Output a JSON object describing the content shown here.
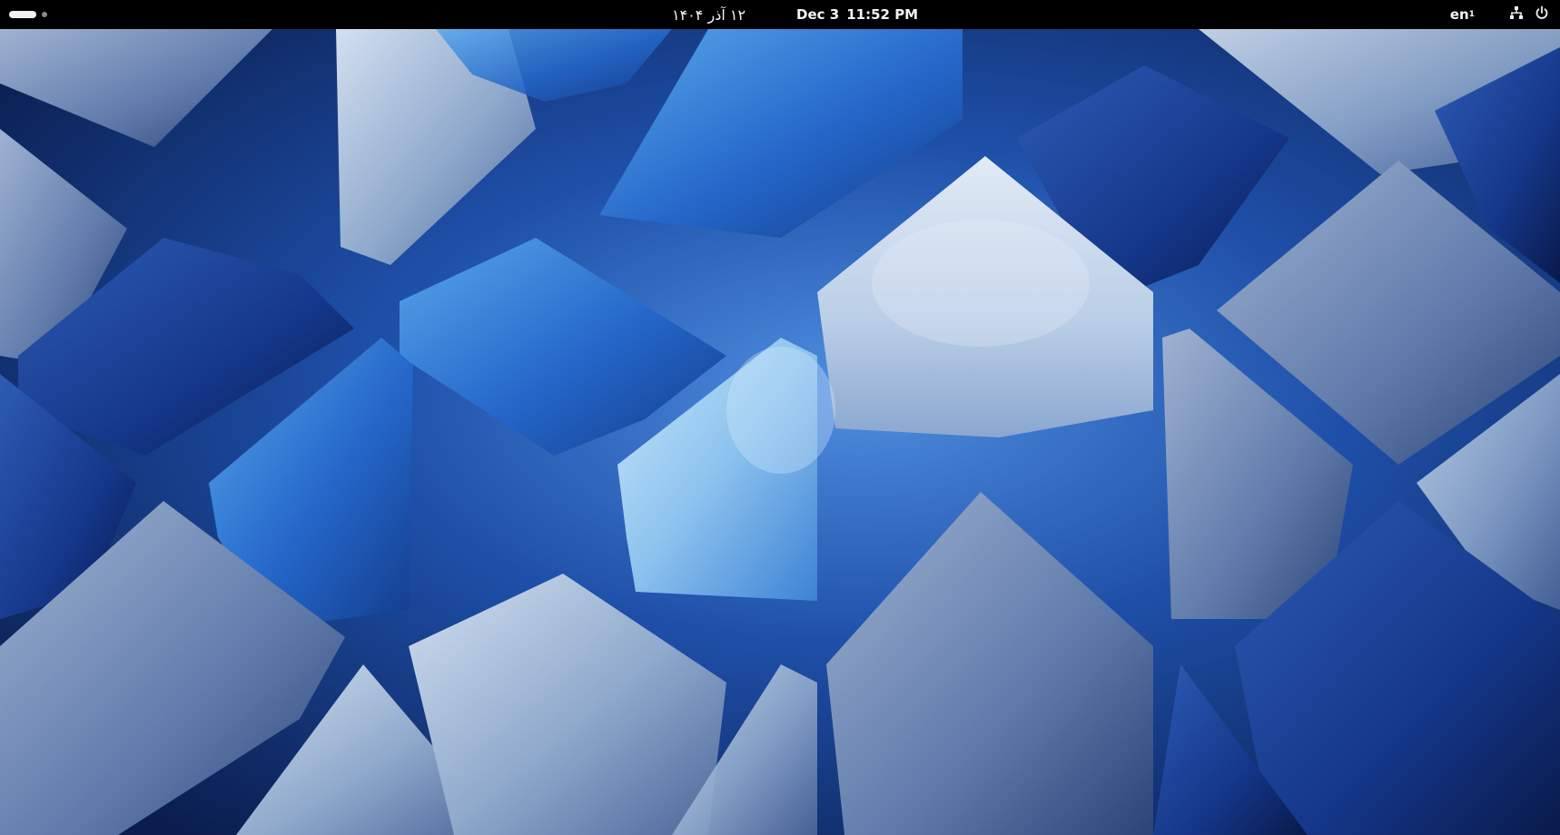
{
  "topbar": {
    "activities_icon": "workspace-indicator-icon",
    "clock": {
      "local_date": "۱۲ آذر ۱۴۰۴",
      "date": "Dec 3",
      "time": "11:52 PM"
    },
    "keyboard_layout": {
      "label": "en",
      "index": "1"
    },
    "network_icon": "wired-network-icon",
    "power_icon": "power-icon"
  },
  "colors": {
    "topbar_bg": "#000000",
    "wallpaper_deep": "#0a1d4d",
    "wallpaper_blue": "#2a6fd6",
    "wallpaper_light": "#b9cde6"
  }
}
